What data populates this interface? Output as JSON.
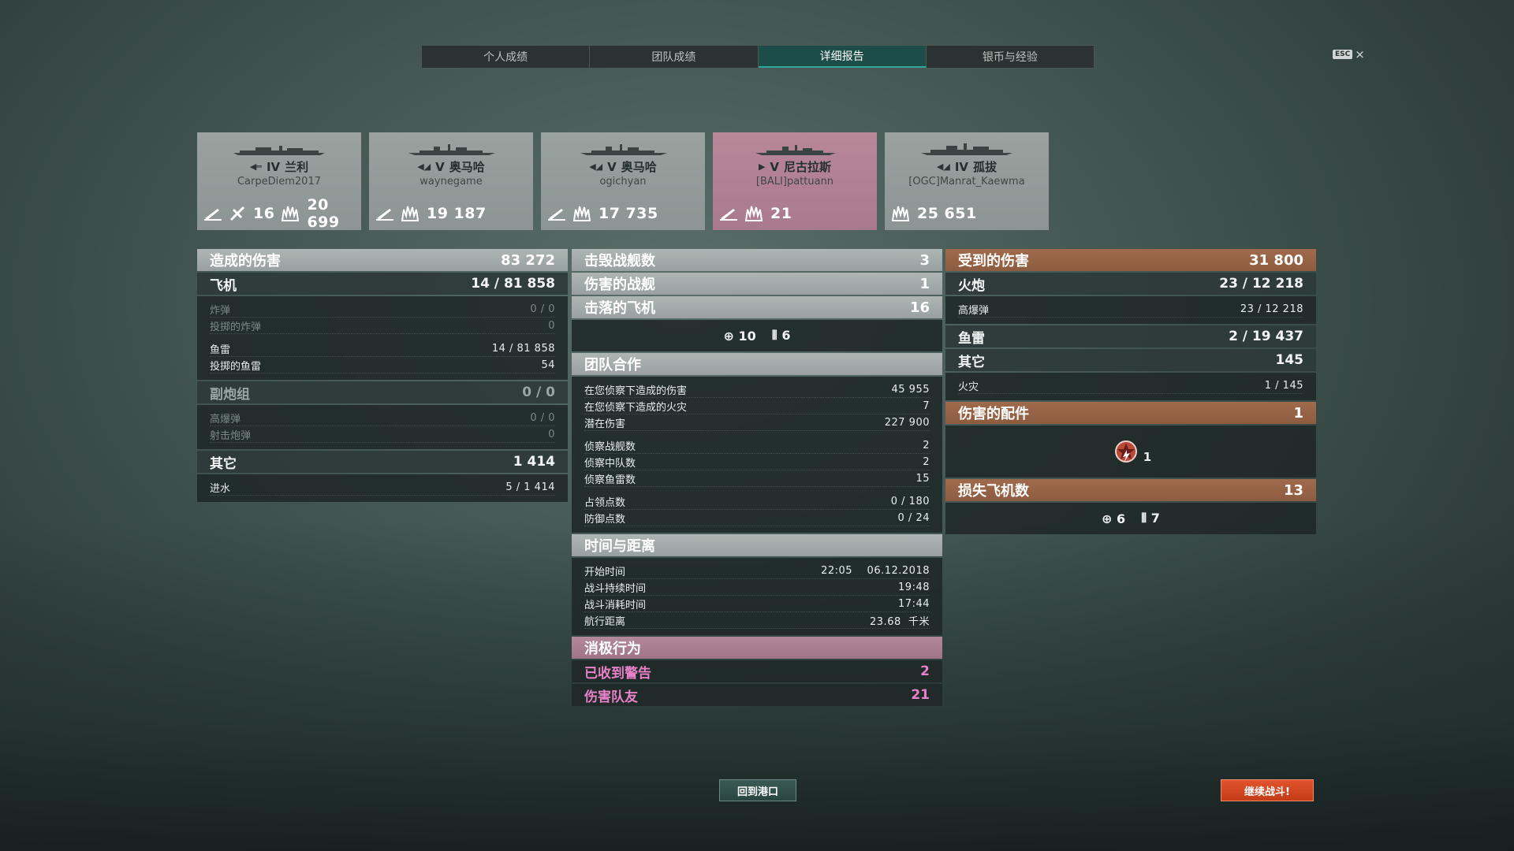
{
  "tabs": [
    "个人成绩",
    "团队成绩",
    "详细报告",
    "银币与经验"
  ],
  "esc": {
    "key": "ESC",
    "close": "×"
  },
  "cards": [
    {
      "tier": "IV",
      "name": "兰利",
      "player": "CarpeDiem2017",
      "planes": "16",
      "damage": "20 699",
      "highlight": false,
      "has_planes": true,
      "has_torp": true
    },
    {
      "tier": "V",
      "name": "奥马哈",
      "player": "waynegame",
      "planes": "",
      "damage": "19 187",
      "highlight": false,
      "has_planes": false,
      "has_torp": true
    },
    {
      "tier": "V",
      "name": "奥马哈",
      "player": "ogichyan",
      "planes": "",
      "damage": "17 735",
      "highlight": false,
      "has_planes": false,
      "has_torp": true
    },
    {
      "tier": "V",
      "name": "尼古拉斯",
      "player": "[BALI]pattuann",
      "planes": "",
      "damage": "21",
      "highlight": true,
      "has_planes": false,
      "has_torp": true
    },
    {
      "tier": "IV",
      "name": "孤拔",
      "player": "[OGC]Manrat_Kaewma",
      "planes": "",
      "damage": "25 651",
      "highlight": false,
      "has_planes": false,
      "has_torp": false
    }
  ],
  "left": {
    "damage_dealt": {
      "label": "造成的伤害",
      "value": "83 272"
    },
    "aircraft": {
      "label": "飞机",
      "value": "14 / 81 858"
    },
    "aircraft_rows": [
      {
        "label": "炸弹",
        "value": "0 / 0",
        "dim": true
      },
      {
        "label": "投掷的炸弹",
        "value": "0",
        "dim": true
      },
      {
        "label": "鱼雷",
        "value": "14 / 81 858",
        "dim": false
      },
      {
        "label": "投掷的鱼雷",
        "value": "54",
        "dim": false
      }
    ],
    "secondary": {
      "label": "副炮组",
      "value": "0 / 0"
    },
    "secondary_rows": [
      {
        "label": "高爆弹",
        "value": "0 / 0"
      },
      {
        "label": "射击炮弹",
        "value": "0"
      }
    ],
    "other": {
      "label": "其它",
      "value": "1 414"
    },
    "other_rows": [
      {
        "label": "进水",
        "value": "5 / 1 414"
      }
    ]
  },
  "middle": {
    "ships_destroyed": {
      "label": "击毁战舰数",
      "value": "3"
    },
    "ships_damaged": {
      "label": "伤害的战舰",
      "value": "1"
    },
    "planes_shot": {
      "label": "击落的飞机",
      "value": "16"
    },
    "planes_icons": {
      "fighters": "10",
      "bombers": "6"
    },
    "teamwork": {
      "label": "团队合作"
    },
    "teamwork_rows_a": [
      {
        "label": "在您侦察下造成的伤害",
        "value": "45 955"
      },
      {
        "label": "在您侦察下造成的火灾",
        "value": "7"
      },
      {
        "label": "潜在伤害",
        "value": "227 900"
      }
    ],
    "teamwork_rows_b": [
      {
        "label": "侦察战舰数",
        "value": "2"
      },
      {
        "label": "侦察中队数",
        "value": "2"
      },
      {
        "label": "侦察鱼雷数",
        "value": "15"
      }
    ],
    "teamwork_rows_c": [
      {
        "label": "占领点数",
        "value": "0 / 180"
      },
      {
        "label": "防御点数",
        "value": "0 / 24"
      }
    ],
    "time": {
      "label": "时间与距离"
    },
    "time_rows": [
      {
        "label": "开始时间",
        "value": "22:05    06.12.2018"
      },
      {
        "label": "战斗持续时间",
        "value": "19:48"
      },
      {
        "label": "战斗消耗时间",
        "value": "17:44"
      },
      {
        "label": "航行距离",
        "value": "23.68  千米"
      }
    ],
    "negative": {
      "label": "消极行为"
    },
    "negative_rows": [
      {
        "label": "已收到警告",
        "value": "2"
      },
      {
        "label": "伤害队友",
        "value": "21"
      }
    ]
  },
  "right": {
    "damage_received": {
      "label": "受到的伤害",
      "value": "31 800"
    },
    "main_battery": {
      "label": "火炮",
      "value": "23 / 12 218"
    },
    "main_rows": [
      {
        "label": "高爆弹",
        "value": "23 / 12 218"
      }
    ],
    "torpedoes": {
      "label": "鱼雷",
      "value": "2 / 19 437"
    },
    "other": {
      "label": "其它",
      "value": "145"
    },
    "other_rows": [
      {
        "label": "火灾",
        "value": "1 / 145"
      }
    ],
    "modules": {
      "label": "伤害的配件",
      "value": "1"
    },
    "module_count": "1",
    "planes_lost": {
      "label": "损失飞机数",
      "value": "13"
    },
    "planes_lost_icons": {
      "fighters": "6",
      "bombers": "7"
    }
  },
  "buttons": {
    "port": "回到港口",
    "continue": "继续战斗!"
  }
}
